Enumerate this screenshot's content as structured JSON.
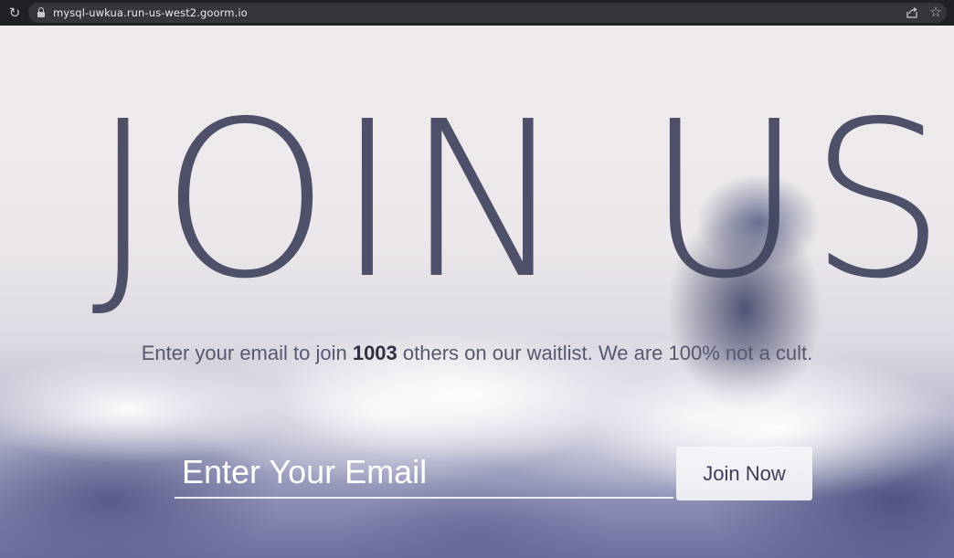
{
  "browser": {
    "url": "mysql-uwkua.run-us-west2.goorm.io",
    "icons": {
      "reload": "reload-icon",
      "lock": "lock-icon",
      "share": "share-icon",
      "bookmark": "star-icon"
    }
  },
  "hero": {
    "headline": "JOIN US",
    "subtitle_before": "Enter your email to join ",
    "subtitle_count": "1003",
    "subtitle_after": " others on our waitlist. We are 100% not a cult."
  },
  "form": {
    "email_placeholder": "Enter Your Email",
    "email_value": "",
    "submit_label": "Join Now"
  },
  "colors": {
    "headline": "#41445f",
    "button_text": "#3b3e58",
    "chrome_bg": "#202124"
  }
}
